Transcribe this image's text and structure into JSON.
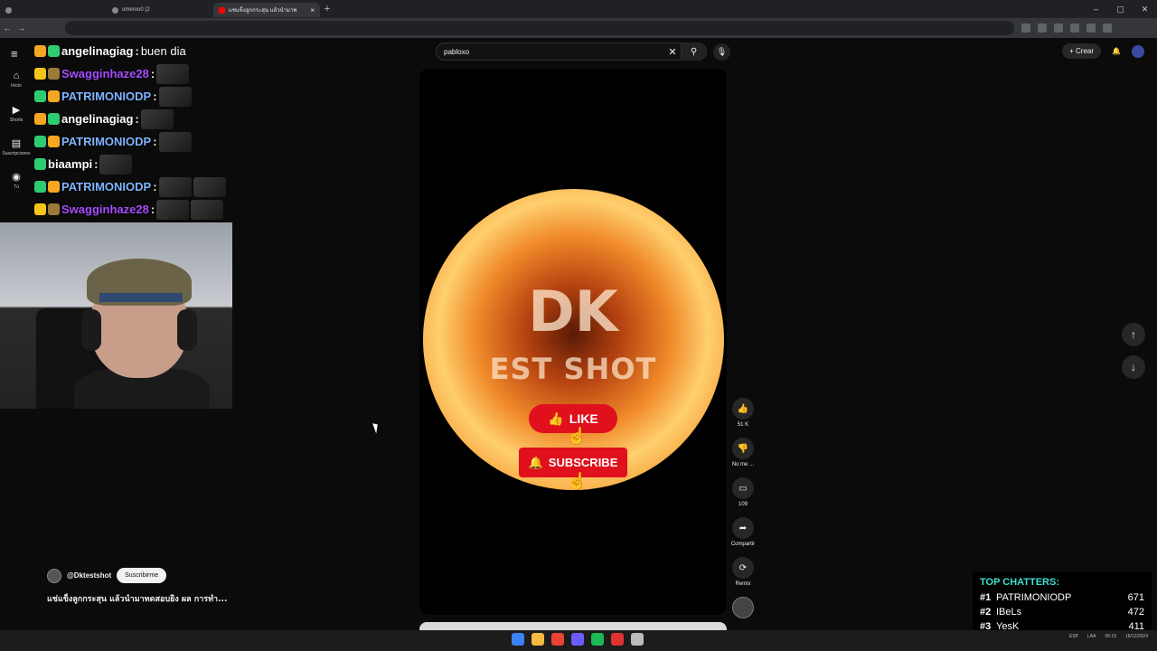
{
  "browser": {
    "tabs": [
      {
        "label": "",
        "active": false
      },
      {
        "label": "omeroo0 (2",
        "active": false
      },
      {
        "label": "แช่แข็งลูกกระสุน แล้วนำมาพ",
        "active": true
      }
    ],
    "new_tab": "+",
    "window_controls": [
      "–",
      "▢",
      "✕"
    ]
  },
  "youtube": {
    "rail": [
      {
        "icon": "home-icon",
        "glyph": "⌂",
        "label": "Inicio"
      },
      {
        "icon": "shorts-icon",
        "glyph": "▶",
        "label": "Shorts"
      },
      {
        "icon": "subscriptions-icon",
        "glyph": "▤",
        "label": "Suscripciones"
      },
      {
        "icon": "you-icon",
        "glyph": "◉",
        "label": "Tú"
      }
    ],
    "search": {
      "query": "pabloxo",
      "clear": "✕",
      "search_glyph": "⚲",
      "mic_glyph": "🎙"
    },
    "create_label": "Crear",
    "create_glyph": "+",
    "bell_glyph": "🔔"
  },
  "chat": [
    {
      "name": "angelinagiag",
      "color": "#ffffff",
      "message": "buen dia",
      "badges": [
        "#f5a623",
        "#2ecc71"
      ],
      "emotes": 0
    },
    {
      "name": "Swagginhaze28",
      "color": "#a64dff",
      "message": "",
      "badges": [
        "#f5c518",
        "#9b7a3a"
      ],
      "emotes": 1
    },
    {
      "name": "PATRIMONIODP",
      "color": "#7fb5ff",
      "message": "",
      "badges": [
        "#2ecc71",
        "#f5a623"
      ],
      "emotes": 1
    },
    {
      "name": "angelinagiag",
      "color": "#ffffff",
      "message": "",
      "badges": [
        "#f5a623",
        "#2ecc71"
      ],
      "emotes": 1
    },
    {
      "name": "PATRIMONIODP",
      "color": "#7fb5ff",
      "message": "",
      "badges": [
        "#2ecc71",
        "#f5a623"
      ],
      "emotes": 1
    },
    {
      "name": "biaampi",
      "color": "#ffffff",
      "message": "",
      "badges": [
        "#2ecc71"
      ],
      "emotes": 1
    },
    {
      "name": "PATRIMONIODP",
      "color": "#7fb5ff",
      "message": "",
      "badges": [
        "#2ecc71",
        "#f5a623"
      ],
      "emotes": 2
    },
    {
      "name": "Swagginhaze28",
      "color": "#a64dff",
      "message": "",
      "badges": [
        "#f5c518",
        "#9b7a3a"
      ],
      "emotes": 2
    }
  ],
  "video": {
    "brand_main": "DK",
    "brand_sub": "EST SHOT",
    "like_label": "LIKE",
    "subscribe_label": "SUBSCRIBE"
  },
  "actions": [
    {
      "name": "like",
      "glyph": "👍",
      "label": "51 K"
    },
    {
      "name": "dislike",
      "glyph": "👎",
      "label": "No me ..."
    },
    {
      "name": "comments",
      "glyph": "▭",
      "label": "109"
    },
    {
      "name": "share",
      "glyph": "➦",
      "label": "Compartir"
    },
    {
      "name": "remix",
      "glyph": "⟳",
      "label": "Remix"
    }
  ],
  "channel": {
    "handle": "@Dktestshot",
    "subscribe_label": "Suscribirme",
    "title": "แช่แข็งลูกกระสุน แล้วนำมาทดสอบยิง ผล การทำ..."
  },
  "nav": {
    "up": "↑",
    "down": "↓"
  },
  "top_chatters": {
    "title": "TOP CHATTERS:",
    "rows": [
      {
        "rank": "#1",
        "user": "PATRIMONIODP",
        "count": "671"
      },
      {
        "rank": "#2",
        "user": "IBeLs",
        "count": "472"
      },
      {
        "rank": "#3",
        "user": "YesK",
        "count": "411"
      }
    ]
  },
  "taskbar": {
    "icons": [
      "#3b82f6",
      "#f5b942",
      "#ea4335",
      "#6b5cff",
      "#1db954",
      "#d33",
      "#bbb"
    ],
    "tray": [
      "ESP",
      "LAA",
      "06:19",
      "18/12/2024"
    ]
  }
}
